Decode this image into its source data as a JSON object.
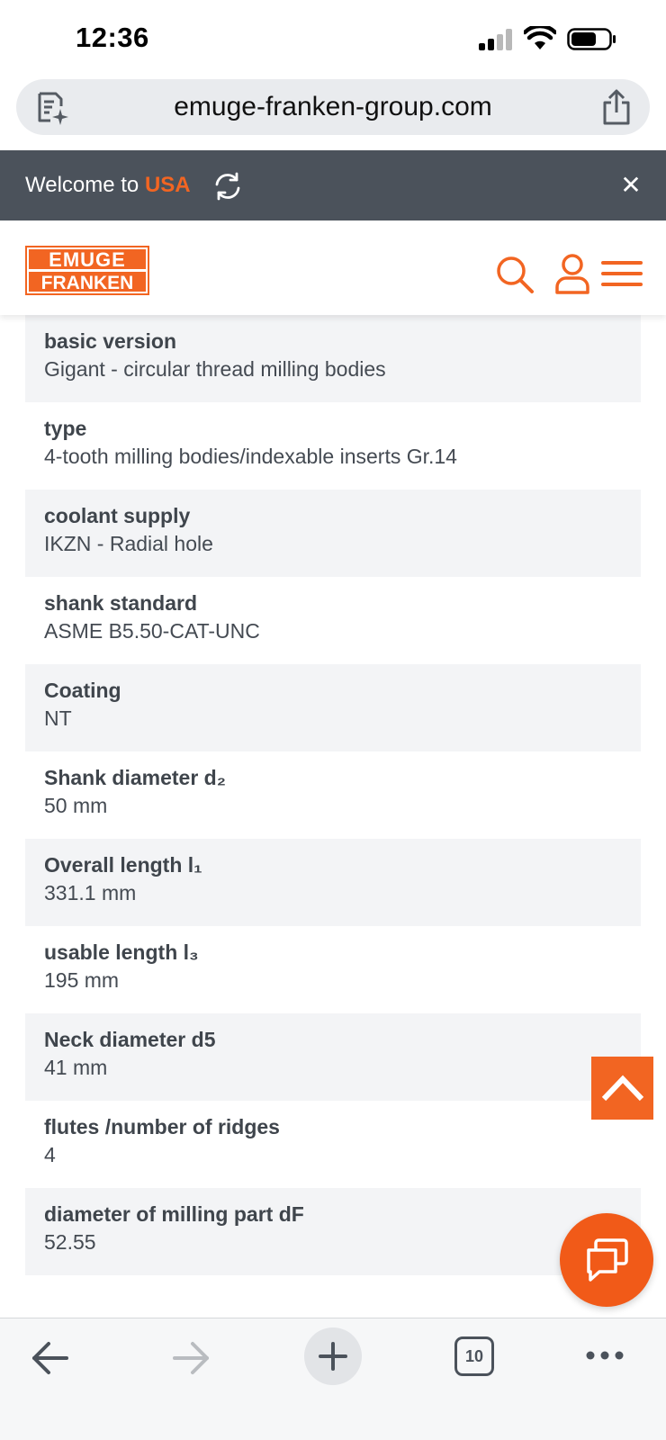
{
  "status_bar": {
    "time": "12:36"
  },
  "browser": {
    "url": "emuge-franken-group.com"
  },
  "banner": {
    "welcome_text": "Welcome to",
    "country": "USA"
  },
  "header": {
    "logo_line1": "EMUGE",
    "logo_line2": "FRANKEN",
    "brand_color": "#f26522"
  },
  "specs": [
    {
      "label": "basic version",
      "value": "Gigant - circular thread milling bodies"
    },
    {
      "label": "type",
      "value": "4-tooth milling bodies/indexable inserts Gr.14"
    },
    {
      "label": "coolant supply",
      "value": "IKZN - Radial hole"
    },
    {
      "label": "shank standard",
      "value": "ASME B5.50-CAT-UNC"
    },
    {
      "label": "Coating",
      "value": "NT"
    },
    {
      "label": "Shank diameter d₂",
      "value": "50 mm"
    },
    {
      "label": "Overall length l₁",
      "value": "331.1 mm"
    },
    {
      "label": "usable length l₃",
      "value": "195 mm"
    },
    {
      "label": "Neck diameter d5",
      "value": "41 mm"
    },
    {
      "label": "flutes /number of ridges",
      "value": "4"
    },
    {
      "label": "diameter of milling part dF",
      "value": "52.55"
    }
  ],
  "toolbar": {
    "tab_count": "10"
  },
  "icons": {
    "reader": "reader-icon",
    "share": "share-icon",
    "refresh": "refresh-icon",
    "close": "close-icon",
    "search": "search-icon",
    "user": "user-icon",
    "menu": "menu-icon",
    "scroll_top": "chevron-up-icon",
    "chat": "chat-icon",
    "back": "arrow-left-icon",
    "forward": "arrow-right-icon",
    "new_tab": "plus-icon",
    "more": "more-icon"
  }
}
